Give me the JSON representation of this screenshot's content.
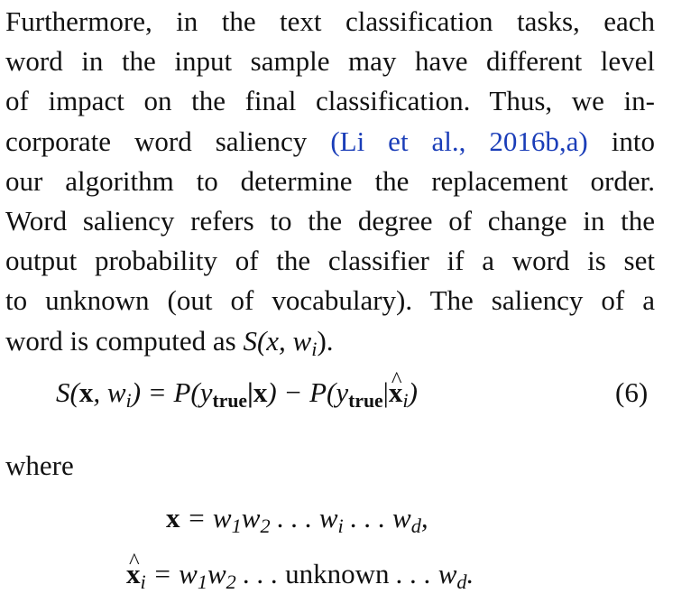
{
  "paragraph": {
    "lines": [
      "Furthermore, in the text classification tasks, each",
      "word in the input sample may have different level",
      "of impact on the final classification. Thus, we in-",
      "corporate word saliency",
      "(Li et al., 2016b,a)",
      "into",
      "our algorithm to determine the replacement order.",
      "Word saliency refers to the degree of change in the",
      "output probability of the classifier if a word is set",
      "to unknown (out of vocabulary). The saliency of a",
      "word is computed as",
      "S(x, w",
      "i",
      ")."
    ]
  },
  "equation6": {
    "lhs_S": "S(",
    "x": "x",
    "lhs_w": ", w",
    "sub_i": "i",
    "eq_mid": ") = P(y",
    "sub_true": "true",
    "bar_x": "|x",
    "minus_p": ") − P(y",
    "bar": "|",
    "xhat": "x",
    "close": ")",
    "number": "(6)"
  },
  "where_label": "where",
  "equation_x": {
    "x": "x",
    "rhs1": " = w",
    "s1": "1",
    "w2": "w",
    "s2": "2",
    "dots1": " . . . w",
    "si": "i",
    "dots2": " . . . w",
    "sd": "d",
    "end": ","
  },
  "equation_xhat": {
    "x": "x",
    "si": "i",
    "rhs1": " = w",
    "s1": "1",
    "w2": "w",
    "s2": "2",
    "dots1": " . . . ",
    "unknown": "unknown",
    "dots2": " . . . w",
    "sd": "d",
    "end": "."
  }
}
